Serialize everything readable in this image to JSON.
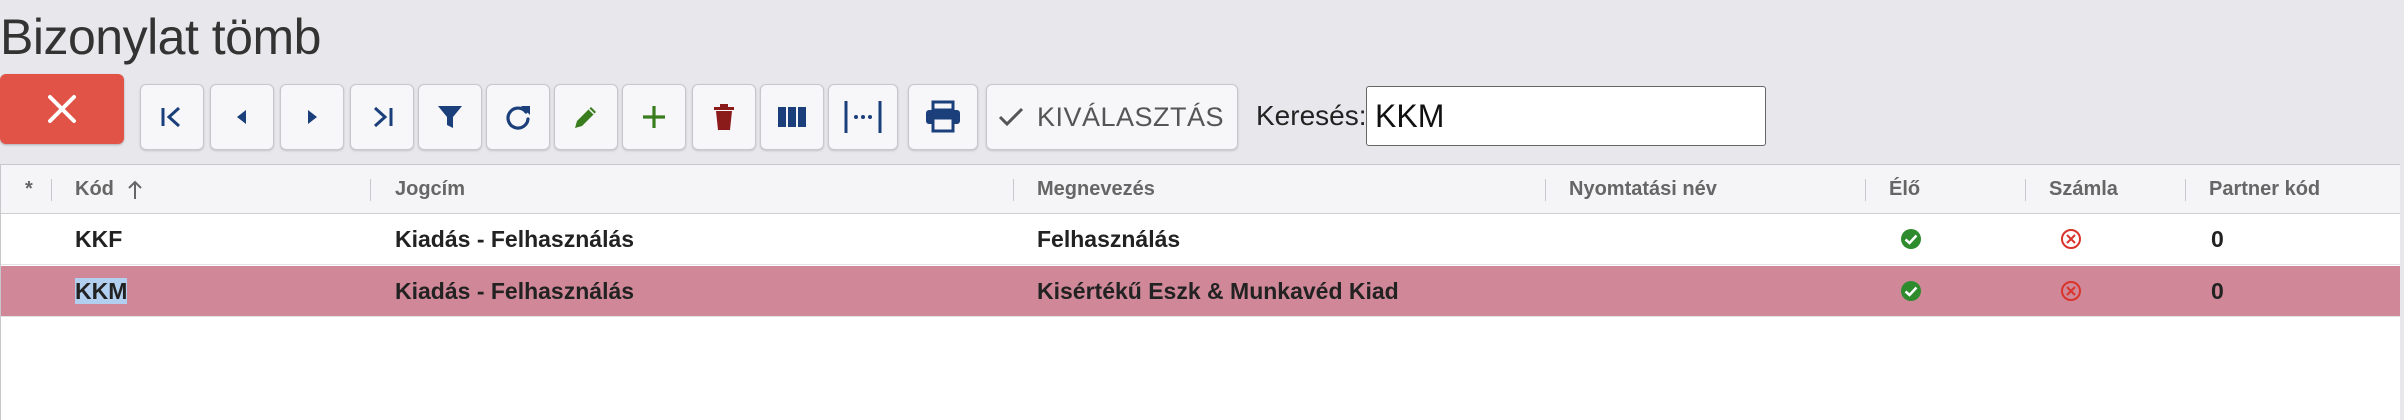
{
  "page": {
    "title": "Bizonylat tömb"
  },
  "toolbar": {
    "buttons": [
      {
        "name": "first-page-button",
        "icon": "first-page-icon"
      },
      {
        "name": "previous-page-button",
        "icon": "triangle-left-icon"
      },
      {
        "name": "next-page-button",
        "icon": "triangle-right-icon"
      },
      {
        "name": "last-page-button",
        "icon": "last-page-icon"
      },
      {
        "name": "filter-button",
        "icon": "filter-icon"
      },
      {
        "name": "refresh-button",
        "icon": "refresh-icon"
      },
      {
        "name": "edit-button",
        "icon": "pencil-icon"
      },
      {
        "name": "add-button",
        "icon": "plus-icon"
      },
      {
        "name": "delete-button",
        "icon": "trash-icon"
      },
      {
        "name": "columns-button",
        "icon": "columns-icon"
      },
      {
        "name": "column-width-button",
        "icon": "column-width-icon"
      },
      {
        "name": "print-button",
        "icon": "printer-icon"
      }
    ],
    "select_label": "KIVÁLASZTÁS",
    "colors": {
      "nav": "#1a3f7a",
      "edit": "#3a7d1e",
      "delete": "#8b1a1a",
      "close": "#e15346"
    }
  },
  "search": {
    "label": "Keresés:",
    "value": "KKM"
  },
  "grid": {
    "columns": [
      {
        "key": "star",
        "label": "*"
      },
      {
        "key": "kod",
        "label": "Kód",
        "sort": "asc"
      },
      {
        "key": "jogcim",
        "label": "Jogcím"
      },
      {
        "key": "megnevezes",
        "label": "Megnevezés"
      },
      {
        "key": "nyomtatasi_nev",
        "label": "Nyomtatási név"
      },
      {
        "key": "elo",
        "label": "Élő"
      },
      {
        "key": "szamla",
        "label": "Számla"
      },
      {
        "key": "partner_kod",
        "label": "Partner kód"
      }
    ],
    "rows": [
      {
        "kod": "KKF",
        "jogcim": "Kiadás - Felhasználás",
        "megnevezes": "Felhasználás",
        "nyomtatasi_nev": "",
        "elo": "check-circle-icon",
        "szamla": "x-circle-icon",
        "partner_kod": "0",
        "selected": false
      },
      {
        "kod": "KKM",
        "jogcim": "Kiadás - Felhasználás",
        "megnevezes": "Kisértékű Eszk & Munkavéd Kiad",
        "nyomtatasi_nev": "",
        "elo": "check-circle-icon",
        "szamla": "x-circle-icon",
        "partner_kod": "0",
        "selected": true
      }
    ],
    "selected_row_color": "#d08898",
    "status_colors": {
      "ok": "#2e8b2e",
      "no": "#d9342b"
    }
  }
}
